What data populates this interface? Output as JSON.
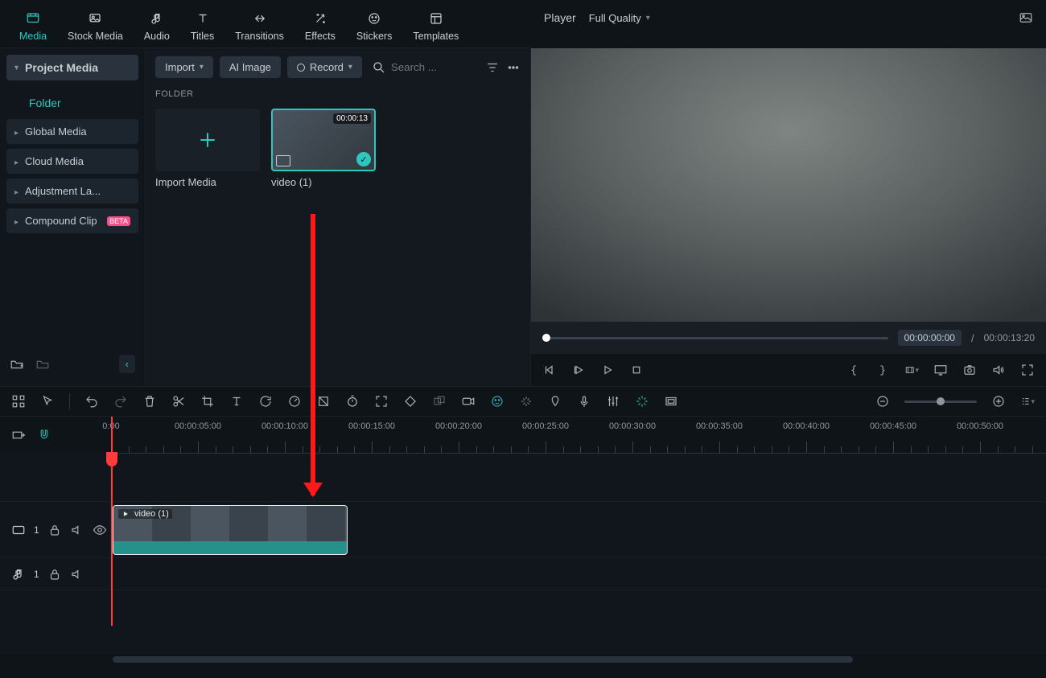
{
  "tabs": {
    "media": "Media",
    "stock": "Stock Media",
    "audio": "Audio",
    "titles": "Titles",
    "transitions": "Transitions",
    "effects": "Effects",
    "stickers": "Stickers",
    "templates": "Templates"
  },
  "sidebar": {
    "project_media": "Project Media",
    "folder": "Folder",
    "items": [
      "Global Media",
      "Cloud Media",
      "Adjustment La...",
      "Compound Clip"
    ],
    "beta_badge": "BETA"
  },
  "media_toolbar": {
    "import": "Import",
    "ai_image": "AI Image",
    "record": "Record",
    "search_placeholder": "Search ..."
  },
  "media_panel": {
    "folder_title": "FOLDER",
    "import_media": "Import Media",
    "clip_name": "video (1)",
    "clip_duration": "00:00:13"
  },
  "player": {
    "title": "Player",
    "quality": "Full Quality",
    "time_current": "00:00:00:00",
    "time_total": "00:00:13:20",
    "separator": "/"
  },
  "timeline": {
    "ruler": [
      "0:00",
      "00:00:05:00",
      "00:00:10:00",
      "00:00:15:00",
      "00:00:20:00",
      "00:00:25:00",
      "00:00:30:00",
      "00:00:35:00",
      "00:00:40:00",
      "00:00:45:00",
      "00:00:50:00"
    ],
    "video_track_num": "1",
    "audio_track_num": "1",
    "clip_label": "video (1)"
  }
}
